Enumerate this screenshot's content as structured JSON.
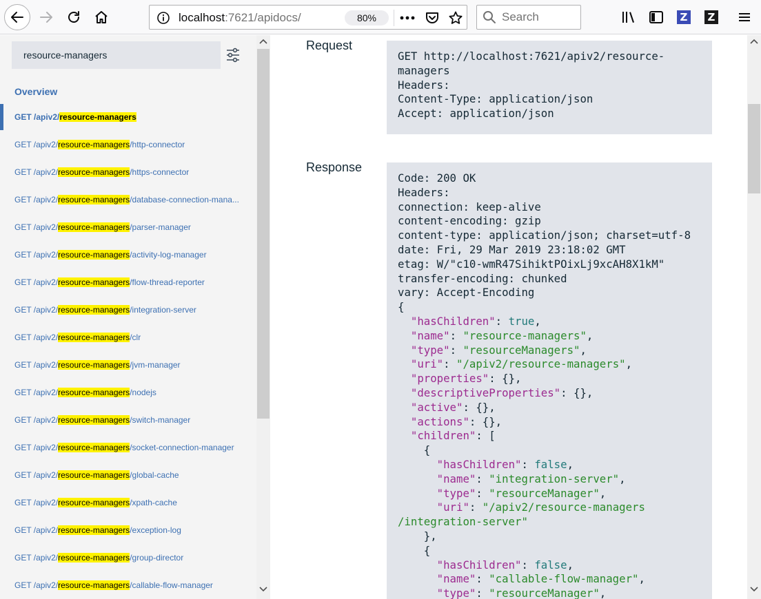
{
  "browser": {
    "url_host": "localhost",
    "url_path": ":7621/apidocs/",
    "zoom": "80%",
    "search_placeholder": "Search"
  },
  "sidebar": {
    "filter_value": "resource-managers",
    "overview_label": "Overview",
    "highlight_term": "resource-managers",
    "items": [
      {
        "prefix": "GET /apiv2/",
        "term": "resource-managers",
        "suffix": ""
      },
      {
        "prefix": "GET /apiv2/",
        "term": "resource-managers",
        "suffix": "/http-connector"
      },
      {
        "prefix": "GET /apiv2/",
        "term": "resource-managers",
        "suffix": "/https-connector"
      },
      {
        "prefix": "GET /apiv2/",
        "term": "resource-managers",
        "suffix": "/database-connection-mana..."
      },
      {
        "prefix": "GET /apiv2/",
        "term": "resource-managers",
        "suffix": "/parser-manager"
      },
      {
        "prefix": "GET /apiv2/",
        "term": "resource-managers",
        "suffix": "/activity-log-manager"
      },
      {
        "prefix": "GET /apiv2/",
        "term": "resource-managers",
        "suffix": "/flow-thread-reporter"
      },
      {
        "prefix": "GET /apiv2/",
        "term": "resource-managers",
        "suffix": "/integration-server"
      },
      {
        "prefix": "GET /apiv2/",
        "term": "resource-managers",
        "suffix": "/clr"
      },
      {
        "prefix": "GET /apiv2/",
        "term": "resource-managers",
        "suffix": "/jvm-manager"
      },
      {
        "prefix": "GET /apiv2/",
        "term": "resource-managers",
        "suffix": "/nodejs"
      },
      {
        "prefix": "GET /apiv2/",
        "term": "resource-managers",
        "suffix": "/switch-manager"
      },
      {
        "prefix": "GET /apiv2/",
        "term": "resource-managers",
        "suffix": "/socket-connection-manager"
      },
      {
        "prefix": "GET /apiv2/",
        "term": "resource-managers",
        "suffix": "/global-cache"
      },
      {
        "prefix": "GET /apiv2/",
        "term": "resource-managers",
        "suffix": "/xpath-cache"
      },
      {
        "prefix": "GET /apiv2/",
        "term": "resource-managers",
        "suffix": "/exception-log"
      },
      {
        "prefix": "GET /apiv2/",
        "term": "resource-managers",
        "suffix": "/group-director"
      },
      {
        "prefix": "GET /apiv2/",
        "term": "resource-managers",
        "suffix": "/callable-flow-manager"
      }
    ]
  },
  "request": {
    "label": "Request",
    "lines": [
      "GET http://localhost:7621/apiv2/resource-",
      "managers",
      "Headers:",
      "Content-Type: application/json",
      "Accept: application/json"
    ]
  },
  "response": {
    "label": "Response",
    "header_lines": [
      "Code: 200 OK",
      "Headers:",
      "connection: keep-alive",
      "content-encoding: gzip",
      "content-type: application/json; charset=utf-8",
      "date: Fri, 29 Mar 2019 23:18:02 GMT",
      "etag: W/\"c10-wmR47SihiktPOixLj9xcAH8X1kM\"",
      "transfer-encoding: chunked",
      "vary: Accept-Encoding"
    ],
    "body_lines": [
      [
        {
          "t": "p",
          "v": "{"
        }
      ],
      [
        {
          "t": "p",
          "v": "  "
        },
        {
          "t": "k",
          "v": "\"hasChildren\""
        },
        {
          "t": "p",
          "v": ": "
        },
        {
          "t": "b",
          "v": "true"
        },
        {
          "t": "p",
          "v": ","
        }
      ],
      [
        {
          "t": "p",
          "v": "  "
        },
        {
          "t": "k",
          "v": "\"name\""
        },
        {
          "t": "p",
          "v": ": "
        },
        {
          "t": "s",
          "v": "\"resource-managers\""
        },
        {
          "t": "p",
          "v": ","
        }
      ],
      [
        {
          "t": "p",
          "v": "  "
        },
        {
          "t": "k",
          "v": "\"type\""
        },
        {
          "t": "p",
          "v": ": "
        },
        {
          "t": "s",
          "v": "\"resourceManagers\""
        },
        {
          "t": "p",
          "v": ","
        }
      ],
      [
        {
          "t": "p",
          "v": "  "
        },
        {
          "t": "k",
          "v": "\"uri\""
        },
        {
          "t": "p",
          "v": ": "
        },
        {
          "t": "s",
          "v": "\"/apiv2/resource-managers\""
        },
        {
          "t": "p",
          "v": ","
        }
      ],
      [
        {
          "t": "p",
          "v": "  "
        },
        {
          "t": "k",
          "v": "\"properties\""
        },
        {
          "t": "p",
          "v": ": {},"
        }
      ],
      [
        {
          "t": "p",
          "v": "  "
        },
        {
          "t": "k",
          "v": "\"descriptiveProperties\""
        },
        {
          "t": "p",
          "v": ": {},"
        }
      ],
      [
        {
          "t": "p",
          "v": "  "
        },
        {
          "t": "k",
          "v": "\"active\""
        },
        {
          "t": "p",
          "v": ": {},"
        }
      ],
      [
        {
          "t": "p",
          "v": "  "
        },
        {
          "t": "k",
          "v": "\"actions\""
        },
        {
          "t": "p",
          "v": ": {},"
        }
      ],
      [
        {
          "t": "p",
          "v": "  "
        },
        {
          "t": "k",
          "v": "\"children\""
        },
        {
          "t": "p",
          "v": ": ["
        }
      ],
      [
        {
          "t": "p",
          "v": "    {"
        }
      ],
      [
        {
          "t": "p",
          "v": "      "
        },
        {
          "t": "k",
          "v": "\"hasChildren\""
        },
        {
          "t": "p",
          "v": ": "
        },
        {
          "t": "b",
          "v": "false"
        },
        {
          "t": "p",
          "v": ","
        }
      ],
      [
        {
          "t": "p",
          "v": "      "
        },
        {
          "t": "k",
          "v": "\"name\""
        },
        {
          "t": "p",
          "v": ": "
        },
        {
          "t": "s",
          "v": "\"integration-server\""
        },
        {
          "t": "p",
          "v": ","
        }
      ],
      [
        {
          "t": "p",
          "v": "      "
        },
        {
          "t": "k",
          "v": "\"type\""
        },
        {
          "t": "p",
          "v": ": "
        },
        {
          "t": "s",
          "v": "\"resourceManager\""
        },
        {
          "t": "p",
          "v": ","
        }
      ],
      [
        {
          "t": "p",
          "v": "      "
        },
        {
          "t": "k",
          "v": "\"uri\""
        },
        {
          "t": "p",
          "v": ": "
        },
        {
          "t": "s",
          "v": "\"/apiv2/resource-managers"
        }
      ],
      [
        {
          "t": "s",
          "v": "/integration-server\""
        }
      ],
      [
        {
          "t": "p",
          "v": "    },"
        }
      ],
      [
        {
          "t": "p",
          "v": "    {"
        }
      ],
      [
        {
          "t": "p",
          "v": "      "
        },
        {
          "t": "k",
          "v": "\"hasChildren\""
        },
        {
          "t": "p",
          "v": ": "
        },
        {
          "t": "b",
          "v": "false"
        },
        {
          "t": "p",
          "v": ","
        }
      ],
      [
        {
          "t": "p",
          "v": "      "
        },
        {
          "t": "k",
          "v": "\"name\""
        },
        {
          "t": "p",
          "v": ": "
        },
        {
          "t": "s",
          "v": "\"callable-flow-manager\""
        },
        {
          "t": "p",
          "v": ","
        }
      ],
      [
        {
          "t": "p",
          "v": "      "
        },
        {
          "t": "k",
          "v": "\"type\""
        },
        {
          "t": "p",
          "v": ": "
        },
        {
          "t": "s",
          "v": "\"resourceManager\""
        },
        {
          "t": "p",
          "v": ","
        }
      ]
    ]
  },
  "icons": {
    "back": "arrow-left-icon",
    "forward": "arrow-right-icon",
    "reload": "reload-icon",
    "home": "home-icon",
    "page_info": "info-icon",
    "page_actions": "ellipsis-icon",
    "pocket": "pocket-icon",
    "bookmark": "star-icon",
    "search": "search-icon",
    "library": "library-icon",
    "sidebar": "sidebar-icon",
    "extension_1": "z-extension-icon",
    "extension_2": "z-extension-icon",
    "menu": "hamburger-menu-icon",
    "filter_settings": "sliders-icon",
    "extension_1_letter": "Z",
    "extension_2_letter": "Z"
  },
  "colors": {
    "link": "#3d70b2",
    "highlight": "#fff200",
    "code_bg": "#e1e4ea",
    "json_key": "#9c2a8f",
    "json_string": "#2b8a2b",
    "json_bool": "#227a7a",
    "extension_1_bg": "#3a4bb5",
    "extension_2_bg": "#1a1a1a"
  }
}
